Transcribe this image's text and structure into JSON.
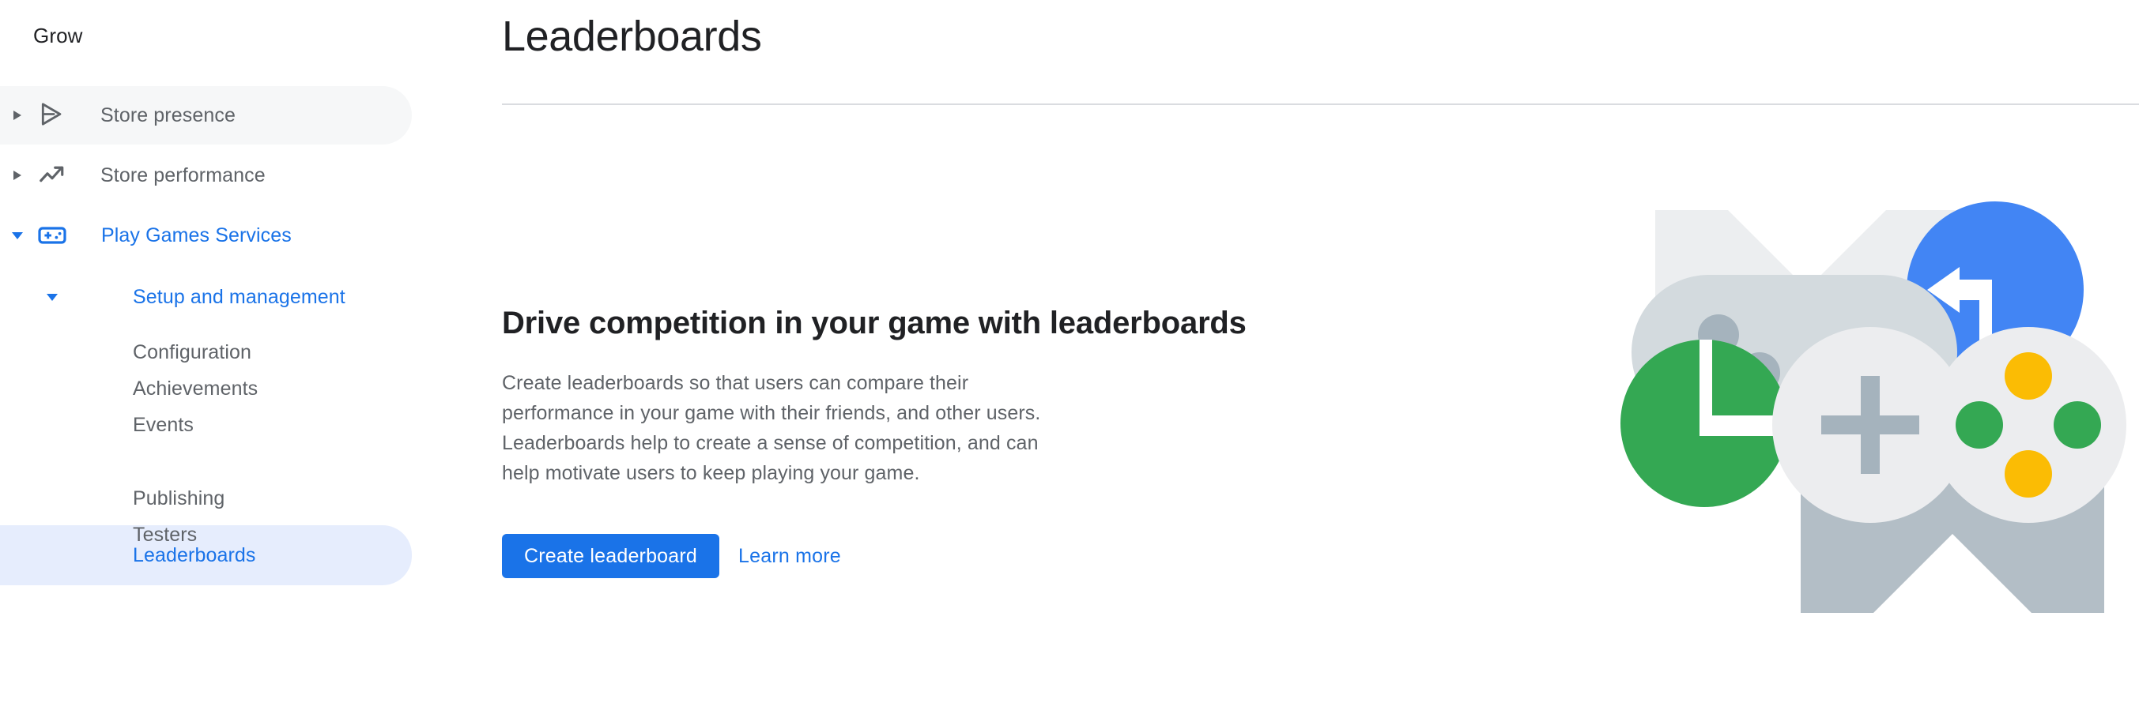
{
  "sidebar": {
    "section_title": "Grow",
    "items": [
      {
        "label": "Store presence",
        "icon": "play-store-icon",
        "level": 1,
        "state": "hovered",
        "twisty": "collapsed"
      },
      {
        "label": "Store performance",
        "icon": "trending-up-icon",
        "level": 1,
        "state": "default",
        "twisty": "collapsed"
      },
      {
        "label": "Play Games Services",
        "icon": "gamepad-icon",
        "level": 1,
        "state": "expanded",
        "twisty": "expanded"
      },
      {
        "label": "Setup and management",
        "icon": "none",
        "level": 2,
        "state": "expanded",
        "twisty": "expanded"
      },
      {
        "label": "Configuration",
        "icon": "none",
        "level": 3,
        "state": "default",
        "twisty": "none"
      },
      {
        "label": "Achievements",
        "icon": "none",
        "level": 3,
        "state": "default",
        "twisty": "none"
      },
      {
        "label": "Events",
        "icon": "none",
        "level": 3,
        "state": "default",
        "twisty": "none"
      },
      {
        "label": "Leaderboards",
        "icon": "none",
        "level": 3,
        "state": "selected",
        "twisty": "none"
      },
      {
        "label": "Publishing",
        "icon": "none",
        "level": 3,
        "state": "default",
        "twisty": "none"
      },
      {
        "label": "Testers",
        "icon": "none",
        "level": 3,
        "state": "default",
        "twisty": "none"
      }
    ]
  },
  "main": {
    "page_title": "Leaderboards",
    "promo": {
      "heading": "Drive competition in your game with leaderboards",
      "body": "Create leaderboards so that users can compare their performance in your game with their friends, and other users. Leaderboards help to create a sense of competition, and can help motivate users to keep playing your game.",
      "primary_button": "Create leaderboard",
      "secondary_link": "Learn more"
    },
    "illustration": {
      "name": "leaderboards-gamepads-illustration",
      "colors": {
        "m_light": "#eceef0",
        "m_dark": "#b3bec6",
        "gamepad_gray": "#d3dade",
        "gamepad_dot_gray": "#a5b3bd",
        "gamepad_white": "#ecedef",
        "blue": "#4285f4",
        "green": "#34a853",
        "yellow": "#fbbc04",
        "white": "#ffffff"
      }
    }
  },
  "colors": {
    "accent_blue": "#1a73e8",
    "selected_pill": "#e6edfd",
    "hover_pill": "#f6f7f8",
    "text_primary": "#202124",
    "text_secondary": "#5f6368",
    "divider": "#dadce0"
  }
}
